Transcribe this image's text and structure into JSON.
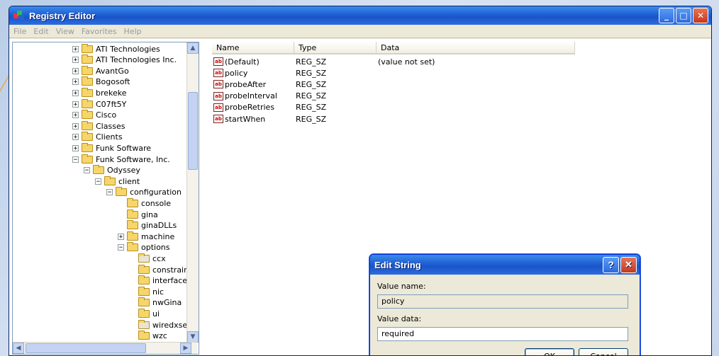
{
  "window": {
    "title": "Registry Editor",
    "controls": {
      "minimize": "_",
      "maximize": "□",
      "close": "✕"
    }
  },
  "menu": [
    "File",
    "Edit",
    "View",
    "Favorites",
    "Help"
  ],
  "tree": {
    "items": [
      {
        "label": "ATI Technologies",
        "expander": "+",
        "level": 0
      },
      {
        "label": "ATI Technologies Inc.",
        "expander": "+",
        "level": 0
      },
      {
        "label": "AvantGo",
        "expander": "+",
        "level": 0
      },
      {
        "label": "Bogosoft",
        "expander": "+",
        "level": 0
      },
      {
        "label": "brekeke",
        "expander": "+",
        "level": 0
      },
      {
        "label": "C07ft5Y",
        "expander": "+",
        "level": 0
      },
      {
        "label": "Cisco",
        "expander": "+",
        "level": 0
      },
      {
        "label": "Classes",
        "expander": "+",
        "level": 0
      },
      {
        "label": "Clients",
        "expander": "+",
        "level": 0
      },
      {
        "label": "Funk Software",
        "expander": "+",
        "level": 0
      },
      {
        "label": "Funk Software, Inc.",
        "expander": "−",
        "level": 0
      },
      {
        "label": "Odyssey",
        "expander": "−",
        "level": 1
      },
      {
        "label": "client",
        "expander": "−",
        "level": 2
      },
      {
        "label": "configuration",
        "expander": "−",
        "level": 3
      },
      {
        "label": "console",
        "expander": "",
        "level": 4
      },
      {
        "label": "gina",
        "expander": "",
        "level": 4
      },
      {
        "label": "ginaDLLs",
        "expander": "",
        "level": 4
      },
      {
        "label": "machine",
        "expander": "+",
        "level": 4
      },
      {
        "label": "options",
        "expander": "−",
        "level": 4
      },
      {
        "label": "ccx",
        "expander": "",
        "level": 5
      },
      {
        "label": "constraints",
        "expander": "",
        "level": 5
      },
      {
        "label": "interface",
        "expander": "",
        "level": 5
      },
      {
        "label": "nic",
        "expander": "",
        "level": 5
      },
      {
        "label": "nwGina",
        "expander": "",
        "level": 5
      },
      {
        "label": "ui",
        "expander": "",
        "level": 5
      },
      {
        "label": "wiredxsec",
        "expander": "",
        "level": 5
      },
      {
        "label": "wzc",
        "expander": "",
        "level": 5
      }
    ]
  },
  "list": {
    "columns": [
      "Name",
      "Type",
      "Data"
    ],
    "rows": [
      {
        "name": "(Default)",
        "type": "REG_SZ",
        "data": "(value not set)"
      },
      {
        "name": "policy",
        "type": "REG_SZ",
        "data": ""
      },
      {
        "name": "probeAfter",
        "type": "REG_SZ",
        "data": ""
      },
      {
        "name": "probeInterval",
        "type": "REG_SZ",
        "data": ""
      },
      {
        "name": "probeRetries",
        "type": "REG_SZ",
        "data": ""
      },
      {
        "name": "startWhen",
        "type": "REG_SZ",
        "data": ""
      }
    ],
    "value_icon_text": "ab"
  },
  "dialog": {
    "title": "Edit String",
    "help": "?",
    "close": "✕",
    "value_name_label": "Value name:",
    "value_name": "policy",
    "value_data_label": "Value data:",
    "value_data": "required",
    "ok_label": "OK",
    "cancel_label": "Cancel"
  }
}
